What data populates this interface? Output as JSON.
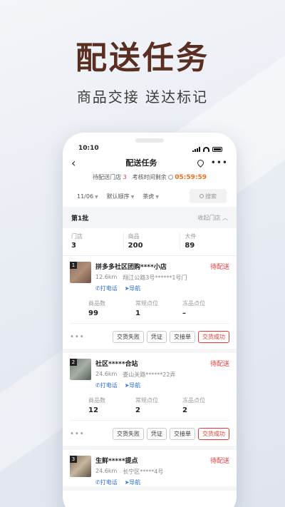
{
  "hero": {
    "title": "配送任务",
    "subtitle": "商品交接  送达标记"
  },
  "status_bar": {
    "time": "10:10"
  },
  "nav": {
    "title": "配送任务"
  },
  "summary": {
    "pending_label": "待配送门店",
    "pending_count": "3",
    "time_label": "考核时间剩余",
    "time_value": "05:59:59"
  },
  "filters": {
    "date": "11/06",
    "sort": "默认顺序",
    "tag": "茶虎",
    "search_placeholder": "搜索"
  },
  "batch": {
    "title": "第1批",
    "toggle": "收起门店",
    "stats": [
      {
        "label": "门店",
        "value": "3"
      },
      {
        "label": "商品",
        "value": "200"
      },
      {
        "label": "大件",
        "value": "89"
      }
    ]
  },
  "stores": [
    {
      "index": "1",
      "name": "拼多多社区团购****小店",
      "status": "待配送",
      "distance": "12.6km",
      "address": "翔江公路3号******1号门",
      "call": "打电话",
      "navigate": "导航",
      "counts": [
        {
          "label": "商品数",
          "value": "99"
        },
        {
          "label": "常规点位",
          "value": "1"
        },
        {
          "label": "冻品点位",
          "value": "–"
        }
      ],
      "buttons": [
        "交货失败",
        "凭证",
        "交接单",
        "交货成功"
      ]
    },
    {
      "index": "2",
      "name": "社区*****合站",
      "status": "待配送",
      "distance": "24.6km",
      "address": "娄山关路******22弄",
      "call": "打电话",
      "navigate": "导航",
      "counts": [
        {
          "label": "商品数",
          "value": "12"
        },
        {
          "label": "常规点位",
          "value": "2"
        },
        {
          "label": "冻品点位",
          "value": "2"
        }
      ],
      "buttons": [
        "交货失败",
        "凭证",
        "交接单",
        "交货成功"
      ]
    },
    {
      "index": "3",
      "name": "生鲜*****提点",
      "status": "待配送",
      "distance": "24.6km",
      "address": "长宁区*****4号",
      "call": "打电话",
      "navigate": "导航"
    }
  ],
  "colors": {
    "accent_red": "#e53935",
    "timer_orange": "#f26b1d",
    "link_blue": "#2f6fe0",
    "hero_brown": "#5a2f22"
  }
}
